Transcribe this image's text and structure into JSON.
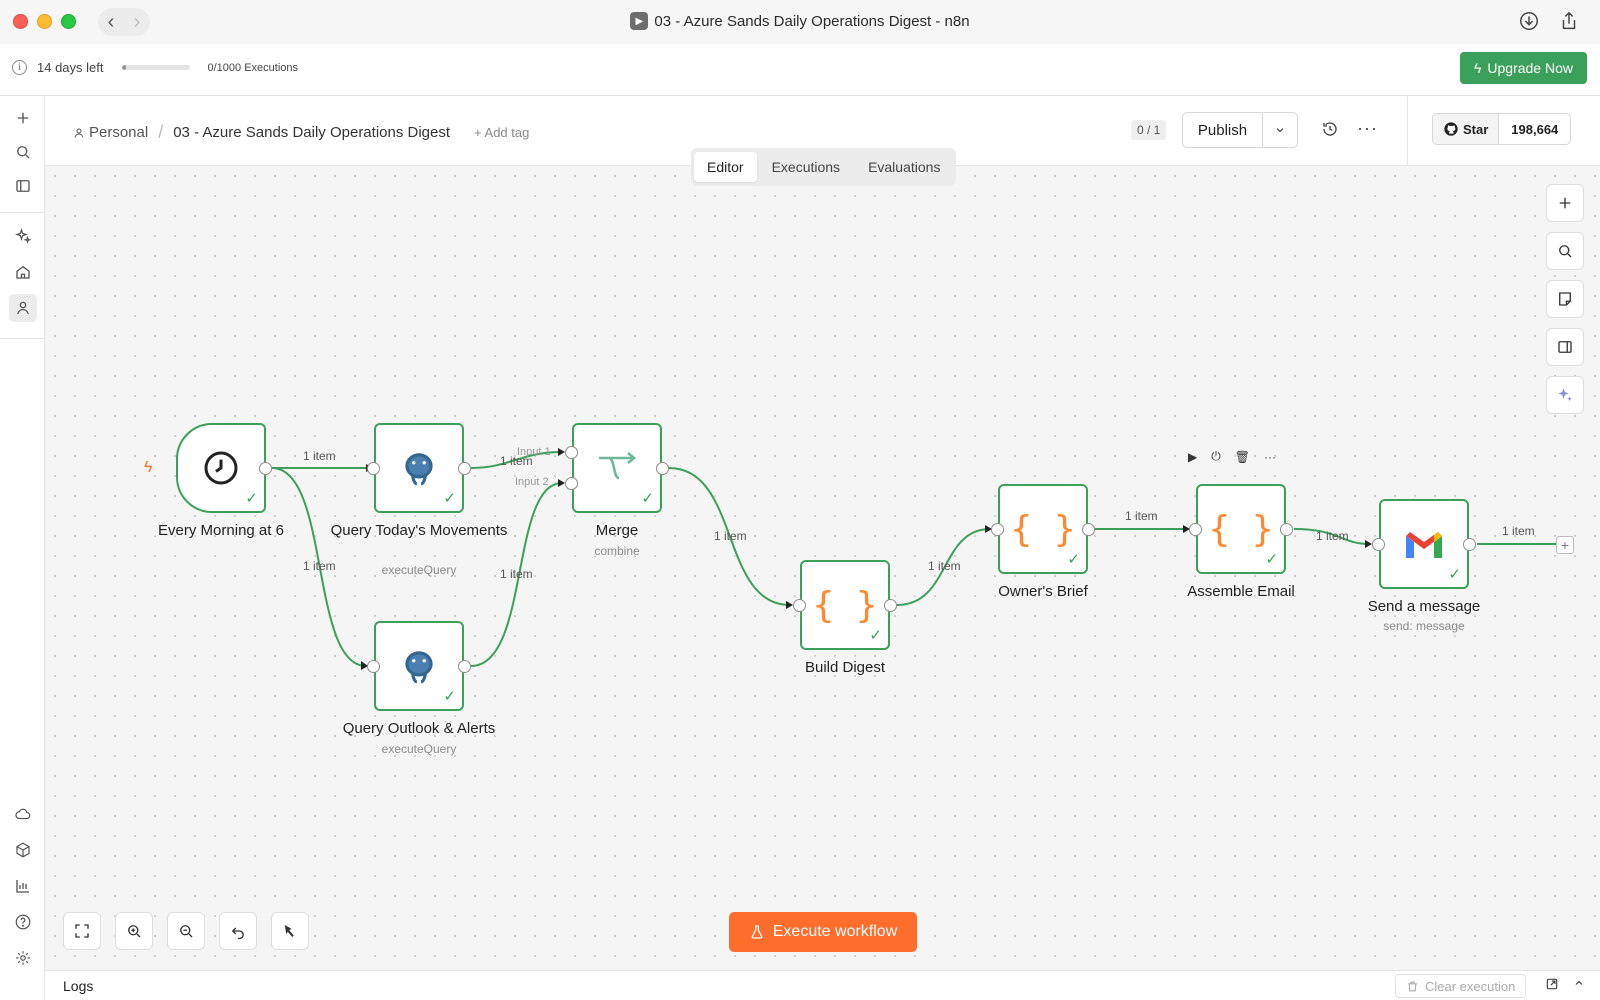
{
  "window": {
    "title": "03 - Azure Sands Daily Operations Digest - n8n"
  },
  "trial": {
    "days_left": "14 days left",
    "executions": "0/1000 Executions",
    "usage_fraction": 0.02,
    "upgrade_label": "Upgrade Now"
  },
  "header": {
    "personal": "Personal",
    "workflow_name": "03 - Azure Sands Daily Operations Digest",
    "add_tag": "+ Add tag",
    "counter": "0 / 1",
    "publish_label": "Publish",
    "github_star": "Star",
    "github_count": "198,664"
  },
  "tabs": [
    "Editor",
    "Executions",
    "Evaluations"
  ],
  "nodes": {
    "trigger": {
      "label": "Every Morning at 6"
    },
    "query_movements": {
      "label": "Query Today's Movements",
      "sub": "executeQuery"
    },
    "query_outlook": {
      "label": "Query Outlook & Alerts",
      "sub": "executeQuery"
    },
    "merge": {
      "label": "Merge",
      "sub": "combine",
      "input1": "Input 1",
      "input2": "Input 2"
    },
    "build_digest": {
      "label": "Build Digest"
    },
    "owners_brief": {
      "label": "Owner's Brief"
    },
    "assemble_email": {
      "label": "Assemble Email"
    },
    "send_message": {
      "label": "Send a message",
      "sub": "send: message"
    }
  },
  "edges": {
    "item_label": "1 item"
  },
  "canvas": {
    "execute_label": "Execute workflow"
  },
  "logs": {
    "label": "Logs",
    "clear_label": "Clear execution"
  },
  "colors": {
    "success": "#3aa05a",
    "accent": "#ff6d2d",
    "upgrade": "#3aa05a"
  }
}
